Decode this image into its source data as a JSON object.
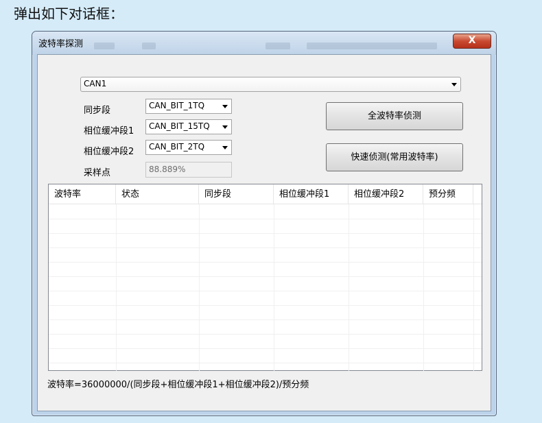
{
  "doc": {
    "heading": "弹出如下对话框："
  },
  "dialog": {
    "title": "波特率探测",
    "close_symbol": "X"
  },
  "channel": {
    "selected": "CAN1"
  },
  "params": {
    "sync_label": "同步段",
    "sync_value": "CAN_BIT_1TQ",
    "phase1_label": "相位缓冲段1",
    "phase1_value": "CAN_BIT_15TQ",
    "phase2_label": "相位缓冲段2",
    "phase2_value": "CAN_BIT_2TQ",
    "sample_label": "采样点",
    "sample_value": "88.889%"
  },
  "buttons": {
    "full_detect": "全波特率侦测",
    "quick_detect": "快速侦测(常用波特率)"
  },
  "table": {
    "columns": [
      "波特率",
      "状态",
      "同步段",
      "相位缓冲段1",
      "相位缓冲段2",
      "预分频"
    ]
  },
  "formula": "波特率=36000000/(同步段+相位缓冲段1+相位缓冲段2)/预分频"
}
